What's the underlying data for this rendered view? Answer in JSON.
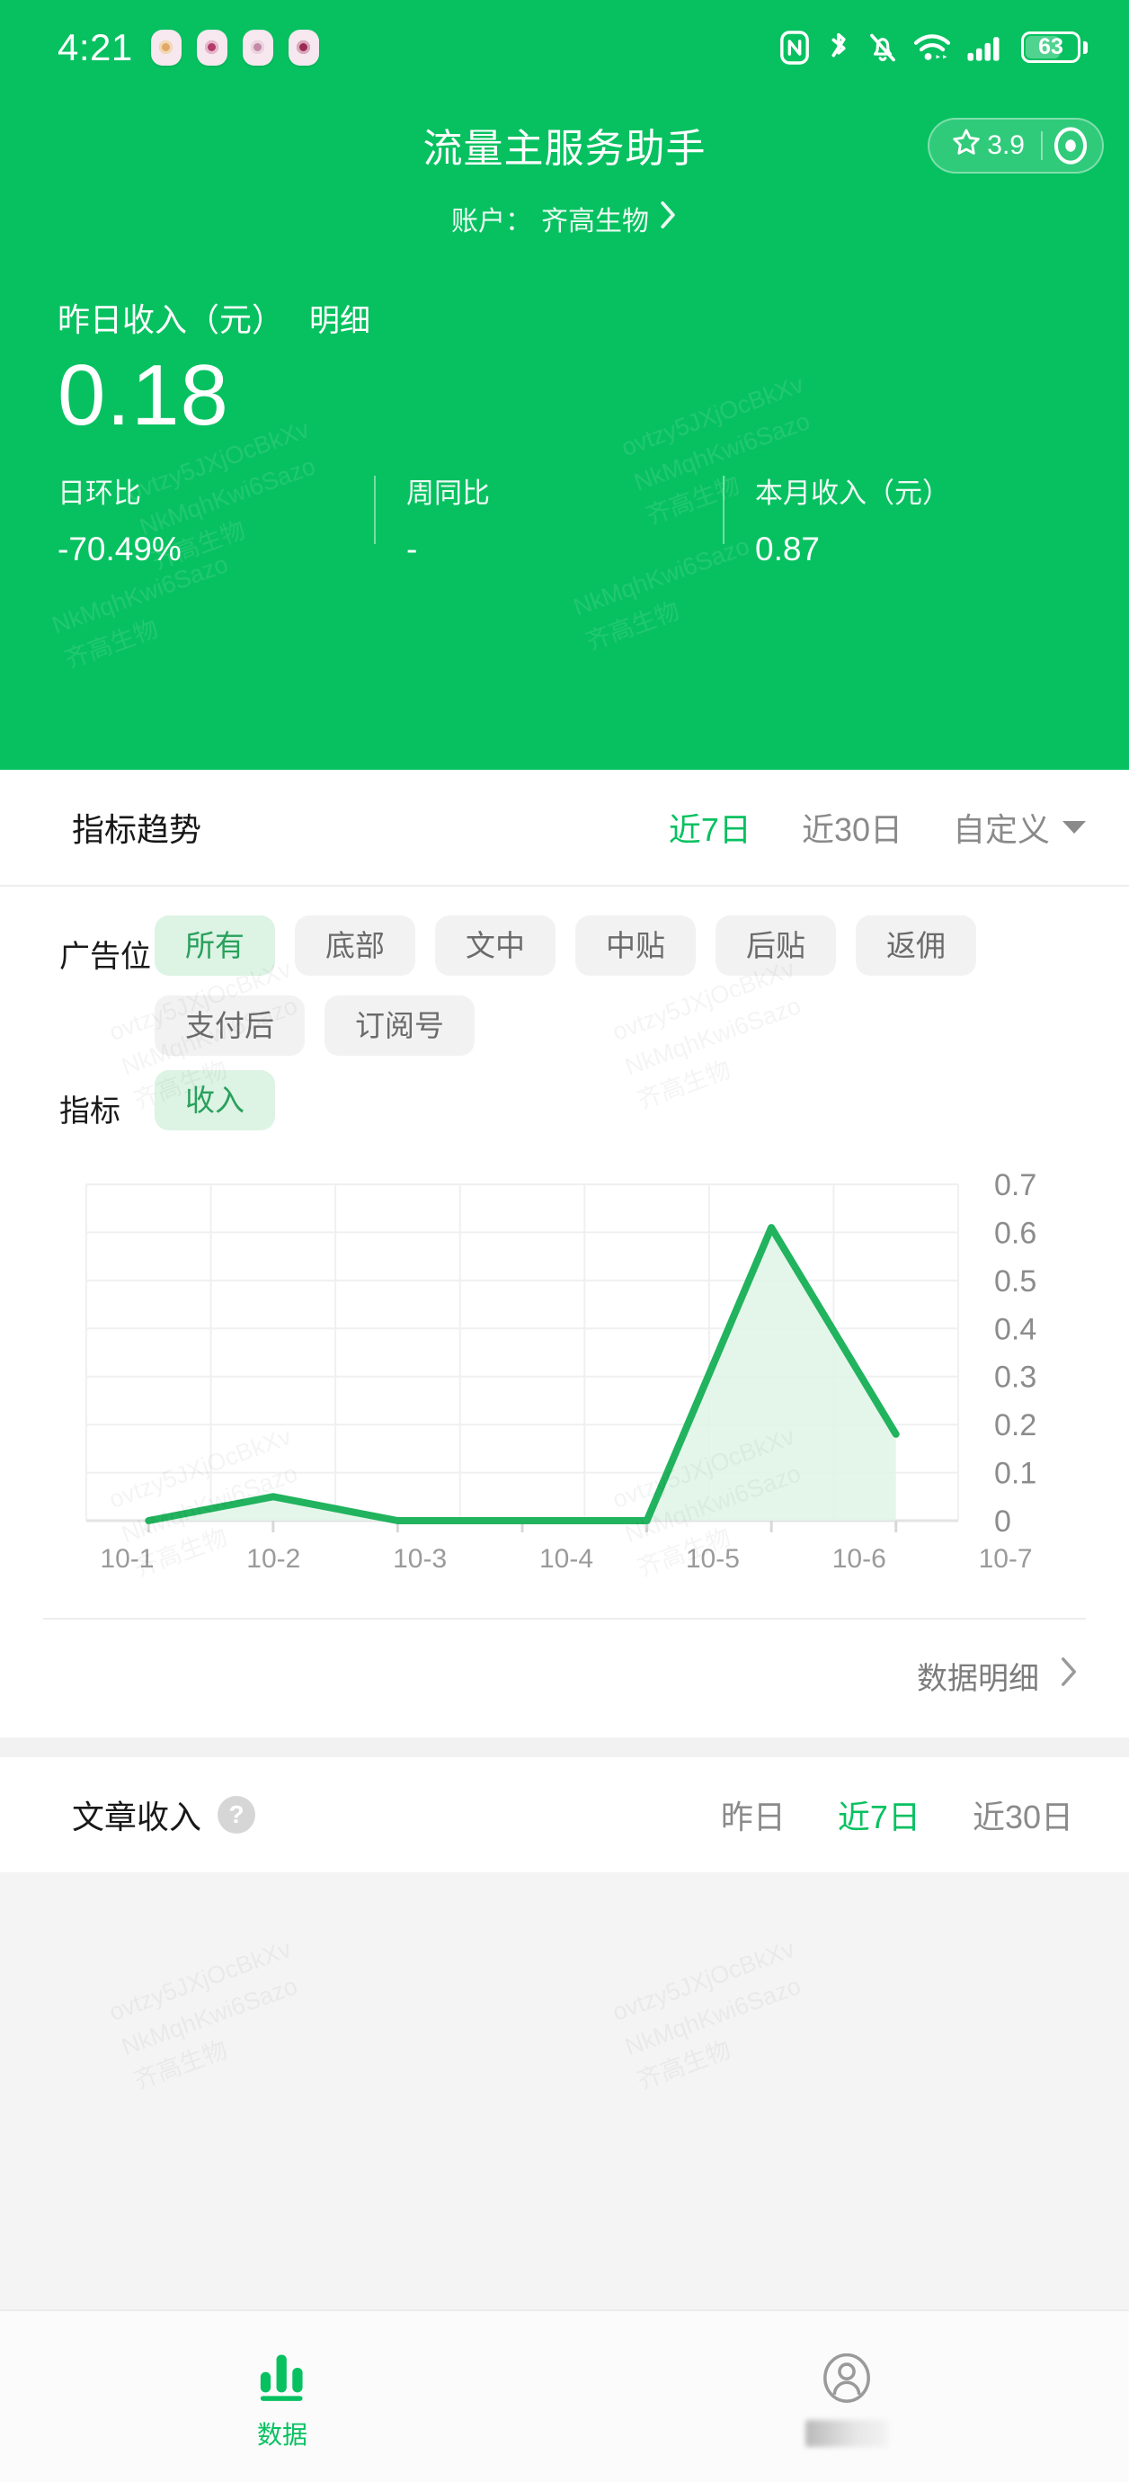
{
  "statusbar": {
    "time": "4:21",
    "icons": [
      "nfc-icon",
      "bluetooth-icon",
      "mute-icon",
      "wifi-icon",
      "signal-icon",
      "battery-icon"
    ],
    "battery_level": "63"
  },
  "header": {
    "title": "流量主服务助手",
    "rating": "3.9",
    "account_label": "账户：",
    "account_name": "齐高生物",
    "income_label": "昨日收入（元）",
    "income_detail_link": "明细",
    "income_value": "0.18",
    "stats": [
      {
        "label": "日环比",
        "value": "-70.49%"
      },
      {
        "label": "周同比",
        "value": "-"
      },
      {
        "label": "本月收入（元）",
        "value": "0.87"
      }
    ],
    "bg_color": "#07c160"
  },
  "trend": {
    "title": "指标趋势",
    "tabs": [
      {
        "label": "近7日",
        "active": true
      },
      {
        "label": "近30日",
        "active": false
      },
      {
        "label": "自定义",
        "active": false
      }
    ],
    "filters": [
      {
        "label": "广告位",
        "chips": [
          {
            "label": "所有",
            "active": true
          },
          {
            "label": "底部",
            "active": false
          },
          {
            "label": "文中",
            "active": false
          },
          {
            "label": "中贴",
            "active": false
          },
          {
            "label": "后贴",
            "active": false
          },
          {
            "label": "返佣",
            "active": false
          },
          {
            "label": "支付后",
            "active": false
          },
          {
            "label": "订阅号",
            "active": false
          }
        ]
      },
      {
        "label": "指标",
        "chips": [
          {
            "label": "收入",
            "active": true
          }
        ]
      }
    ],
    "detail_link": "数据明细"
  },
  "chart_data": {
    "type": "line",
    "title": "指标趋势",
    "xlabel": "",
    "ylabel": "",
    "categories": [
      "10-1",
      "10-2",
      "10-3",
      "10-4",
      "10-5",
      "10-6",
      "10-7"
    ],
    "values": [
      0,
      0.05,
      0,
      0,
      0,
      0.61,
      0.18
    ],
    "yticks": [
      "0",
      "0.1",
      "0.2",
      "0.3",
      "0.4",
      "0.5",
      "0.6",
      "0.7"
    ],
    "ylim": [
      0,
      0.7
    ],
    "grid": true,
    "legend": "none",
    "series": [
      {
        "name": "收入",
        "values": [
          0,
          0.05,
          0,
          0,
          0,
          0.61,
          0.18
        ],
        "color": "#22b35e",
        "fill": "#dff4e6"
      }
    ]
  },
  "article_income": {
    "title": "文章收入",
    "help_badge": "?",
    "tabs": [
      {
        "label": "昨日",
        "active": false
      },
      {
        "label": "近7日",
        "active": true
      },
      {
        "label": "近30日",
        "active": false
      }
    ]
  },
  "tabbar": {
    "items": [
      {
        "label": "数据",
        "icon": "bar-chart-icon",
        "active": true
      },
      {
        "label": "",
        "icon": "person-icon",
        "active": false
      }
    ]
  },
  "watermark": {
    "line1": "ovtzy5JXjOcBkXv",
    "line2": "NkMqhKwi6Sazo",
    "line3": "齐高生物"
  }
}
